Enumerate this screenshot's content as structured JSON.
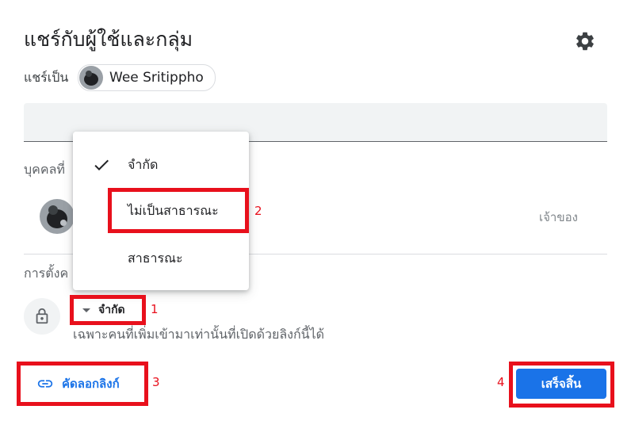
{
  "dialog": {
    "title": "แชร์กับผู้ใช้และกลุ่ม",
    "settings_icon": "gear-icon"
  },
  "share_as": {
    "label": "แชร์เป็น",
    "account_name": "Wee Sritippho"
  },
  "people_section": {
    "heading_visible": "บุคคลที่",
    "owner_role": "เจ้าของ"
  },
  "general_access": {
    "heading_visible": "การตั้งค",
    "selected": "จำกัด",
    "description": "เฉพาะคนที่เพิ่มเข้ามาเท่านั้นที่เปิดด้วยลิงก์นี้ได้"
  },
  "access_menu": {
    "options": [
      {
        "label": "จำกัด",
        "checked": true
      },
      {
        "label": "ไม่เป็นสาธารณะ",
        "checked": false
      },
      {
        "label": "สาธารณะ",
        "checked": false
      }
    ]
  },
  "footer": {
    "copy_link_label": "คัดลอกลิงก์",
    "done_label": "เสร็จสิ้น"
  },
  "annotations": {
    "step1": "1",
    "step2": "2",
    "step3": "3",
    "step4": "4"
  },
  "colors": {
    "accent": "#1a73e8",
    "highlight": "#e8101c"
  }
}
